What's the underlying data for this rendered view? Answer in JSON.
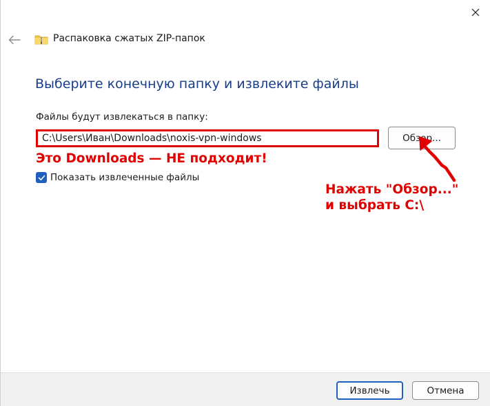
{
  "window": {
    "close_icon": "close-icon"
  },
  "header": {
    "back_icon": "back-arrow-icon",
    "folder_icon": "zip-folder-icon",
    "title": "Распаковка сжатых ZIP-папок"
  },
  "main": {
    "heading": "Выберите конечную папку и извлеките файлы",
    "path_label": "Файлы будут извлекаться в папку:",
    "path_value": "C:\\Users\\Иван\\Downloads\\noxis-vpn-windows",
    "browse_label": "Обзор...",
    "show_files_label": "Показать извлеченные файлы",
    "show_files_checked": true
  },
  "annotations": {
    "wrong_location": "Это Downloads — НЕ подходит!",
    "instruction_line1": "Нажать \"Обзор...\"",
    "instruction_line2": "и выбрать C:\\",
    "color": "#e00000"
  },
  "footer": {
    "extract_label": "Извлечь",
    "cancel_label": "Отмена"
  },
  "colors": {
    "heading": "#1a3d8a",
    "accent": "#1f5fbf",
    "footer_bg": "#f0f0f0"
  }
}
